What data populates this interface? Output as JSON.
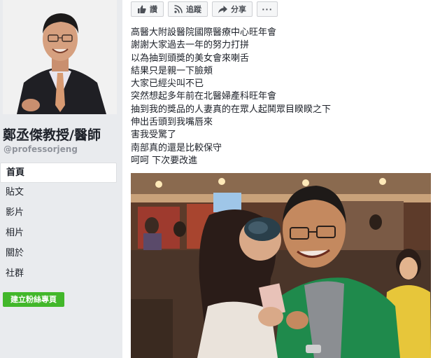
{
  "sidebar": {
    "page_name": "鄭丞傑教授/醫師",
    "handle": "@professorjeng",
    "nav": [
      {
        "label": "首頁",
        "active": true
      },
      {
        "label": "貼文",
        "active": false
      },
      {
        "label": "影片",
        "active": false
      },
      {
        "label": "相片",
        "active": false
      },
      {
        "label": "關於",
        "active": false
      },
      {
        "label": "社群",
        "active": false
      }
    ],
    "create_button": "建立粉絲專頁"
  },
  "actions": {
    "like": "讚",
    "follow": "追蹤",
    "share": "分享",
    "more": "···"
  },
  "post": {
    "lines": [
      "高醫大附設醫院國際醫療中心旺年會",
      "謝謝大家過去一年的努力打拼",
      "以為抽到頭獎的美女會來喇舌",
      "結果只是親一下臉頰",
      "大家已經尖叫不已",
      "突然想起多年前在北醫婦產科旺年會",
      "抽到我的獎品的人妻真的在眾人起鬨眾目睽睽之下",
      "伸出舌頭到我嘴唇來",
      "害我受驚了",
      "南部真的還是比較保守",
      "呵呵 下次要改進"
    ]
  },
  "colors": {
    "sidebar_bg": "#e9ebee",
    "create_button_bg": "#42b72a",
    "text": "#1d2129",
    "muted": "#90949c"
  },
  "icons": [
    "like-icon",
    "rss-icon",
    "share-arrow-icon",
    "more-dots-icon"
  ]
}
